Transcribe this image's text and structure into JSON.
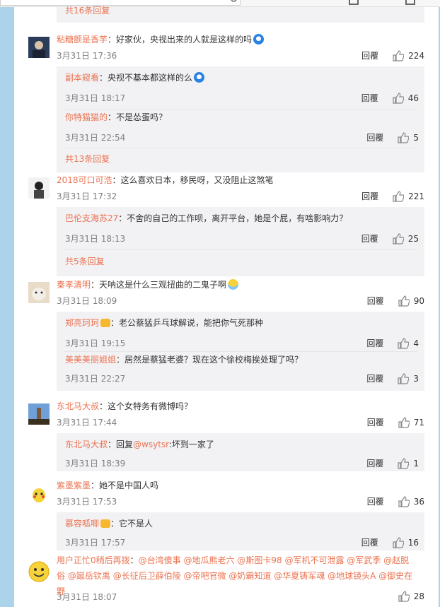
{
  "top_more": "共16条回复",
  "comments": [
    {
      "user": "粘糖颤是香芋",
      "text": "：好家伙，央视出来的人就是这样的吗",
      "time": "3月31日 17:36",
      "reply": "回覆",
      "likes": "224",
      "subs": [
        {
          "user": "副本窥看",
          "text": "：央视不基本都这样的么",
          "time": "3月31日 18:17",
          "reply": "回覆",
          "likes": "46"
        },
        {
          "user": "你特猫猫的",
          "text": "：不是怂蛋吗？",
          "time": "3月31日 22:54",
          "reply": "回覆",
          "likes": "5"
        }
      ],
      "more": "共13条回复"
    },
    {
      "user": "2018可口可浩",
      "text": "：这么喜欢日本，移民呀，又没阻止这煞笔",
      "time": "3月31日 17:32",
      "reply": "回覆",
      "likes": "221",
      "subs": [
        {
          "user": "巴伦支海苏27",
          "text": "：不舍的自己的工作呗，离开平台，她是个屁，有啥影响力？",
          "time": "3月31日 18:13",
          "reply": "回覆",
          "likes": "25"
        }
      ],
      "more": "共5条回复"
    },
    {
      "user": "秦孝清明",
      "text": "：天呐这是什么三观扭曲的二鬼子啊",
      "time": "3月31日 18:09",
      "reply": "回覆",
      "likes": "90",
      "subs": [
        {
          "user": "郑亮珂珂",
          "text": "：老公蔡猛乒乓球解说，能把你气死那种",
          "time": "3月31日 19:15",
          "reply": "回覆",
          "likes": "4"
        },
        {
          "user": "美美美丽姐姐",
          "text": "：居然是蔡猛老婆？现在这个徐校梅挨处理了吗？",
          "time": "3月31日 22:27",
          "reply": "回覆",
          "likes": "3"
        }
      ]
    },
    {
      "user": "东北马大叔",
      "text": "：这个女特务有微博吗？",
      "time": "3月31日 17:44",
      "reply": "回覆",
      "likes": "71",
      "subs": [
        {
          "user": "东北马大叔",
          "text_pre": "：回复",
          "mention": "@wsytsr",
          "text": ":坏到一家了",
          "time": "3月31日 18:39",
          "reply": "回覆",
          "likes": "1"
        }
      ]
    },
    {
      "user": "紫墨紫墨",
      "text": "：她不是中国人吗",
      "time": "3月31日 17:53",
      "reply": "回覆",
      "likes": "36",
      "subs": [
        {
          "user": "慕容呱唧",
          "text": "：它不是人",
          "time": "3月31日 17:57",
          "reply": "回覆",
          "likes": "16"
        }
      ]
    },
    {
      "user": "用户正忙0稍后再拨",
      "text": "：",
      "time": "3月31日 18:07",
      "reply": "回覆",
      "likes": "28",
      "mentions": [
        "@台湾傻事",
        "@地瓜熊老六",
        "@斯图卡98",
        "@军机不可泄露",
        "@军武季",
        "@赵脱俗",
        "@蹴岳钦禹",
        "@长征后卫薛伯陵",
        "@帝吧官微",
        "@奶霸知道",
        "@华夏铸军魂",
        "@地球镜头A",
        "@御史在野"
      ]
    }
  ]
}
